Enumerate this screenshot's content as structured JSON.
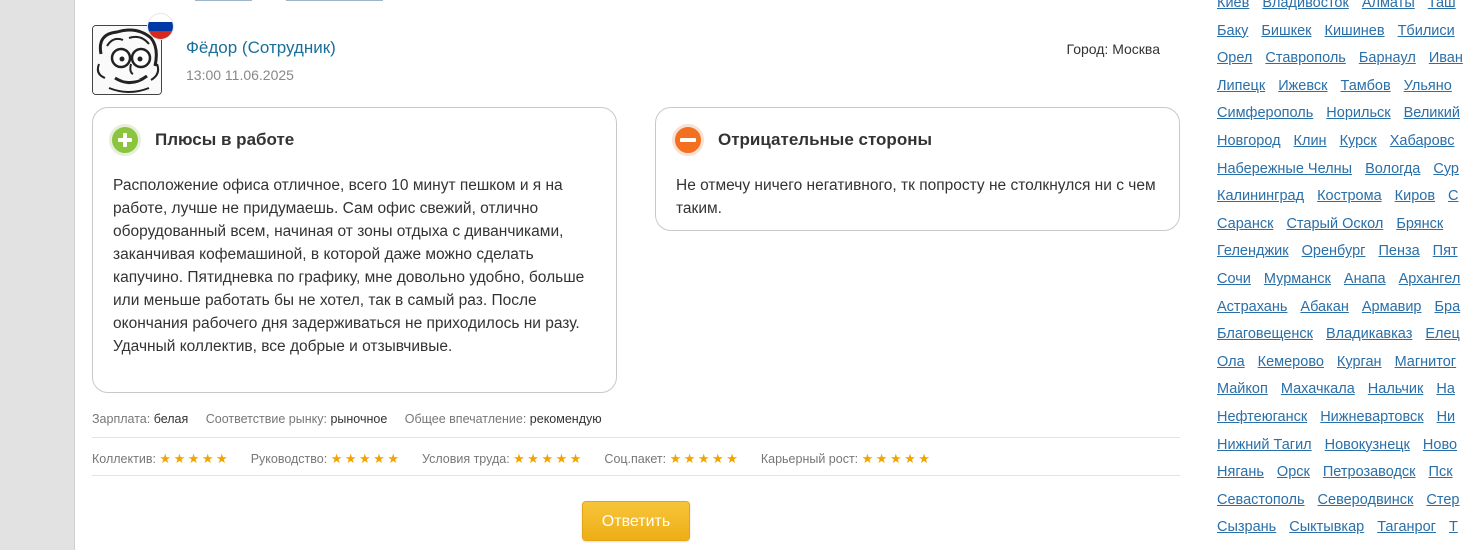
{
  "review": {
    "author_name": "Фёдор (Сотрудник)",
    "datetime": "13:00 11.06.2025",
    "city": "Город: Москва",
    "avatar_icon": "cartoon-face-avatar",
    "flag_icon": "russia-flag-icon",
    "pros": {
      "title": "Плюсы в работе",
      "icon": "plus-circle-icon",
      "text": "Расположение офиса отличное, всего 10 минут пешком и я на работе, лучше не придумаешь. Сам офис свежий, отлично оборудованный всем, начиная от зоны отдыха с диванчиками, заканчивая кофемашиной, в которой даже можно сделать капучино. Пятидневка по графику, мне довольно удобно, больше или меньше работать бы не хотел, так в самый раз. После окончания рабочего дня задерживаться не приходилось ни разу. Удачный коллектив, все добрые и отзывчивые."
    },
    "cons": {
      "title": "Отрицательные стороны",
      "icon": "minus-circle-icon",
      "text": "Не отмечу ничего негативного, тк попросту не столкнулся ни с чем таким."
    },
    "meta": [
      {
        "label": "Зарплата:",
        "value": "белая"
      },
      {
        "label": "Соответствие рынку:",
        "value": "рыночное"
      },
      {
        "label": "Общее впечатление:",
        "value": "рекомендую"
      }
    ],
    "ratings": [
      {
        "label": "Коллектив:",
        "stars": 5
      },
      {
        "label": "Руководство:",
        "stars": 5
      },
      {
        "label": "Условия труда:",
        "stars": 5
      },
      {
        "label": "Соц.пакет:",
        "stars": 5
      },
      {
        "label": "Карьерный рост:",
        "stars": 5
      }
    ],
    "reply_label": "Ответить"
  },
  "colors": {
    "link": "#2a6fa8",
    "author": "#1a6f9a",
    "star": "#f0a400",
    "button": "#f2b824",
    "plus": "#8bc53f",
    "minus": "#f37021"
  },
  "cities": [
    [
      "Киев",
      "Владивосток",
      "Алматы",
      "Таш"
    ],
    [
      "Баку",
      "Бишкек",
      "Кишинев",
      "Тбилиси"
    ],
    [
      "Орел",
      "Ставрополь",
      "Барнаул",
      "Иван"
    ],
    [
      "Липецк",
      "Ижевск",
      "Тамбов",
      "Ульяно"
    ],
    [
      "Симферополь",
      "Норильск",
      "Великий"
    ],
    [
      "Новгород",
      "Клин",
      "Курск",
      "Хабаровс"
    ],
    [
      "Набережные Челны",
      "Вологда",
      "Сур"
    ],
    [
      "Калининград",
      "Кострома",
      "Киров",
      "С"
    ],
    [
      "Саранск",
      "Старый Оскол",
      "Брянск"
    ],
    [
      "Геленджик",
      "Оренбург",
      "Пенза",
      "Пят"
    ],
    [
      "Сочи",
      "Мурманск",
      "Анапа",
      "Архангел"
    ],
    [
      "Астрахань",
      "Абакан",
      "Армавир",
      "Бра"
    ],
    [
      "Благовещенск",
      "Владикавказ",
      "Елец"
    ],
    [
      "Ола",
      "Кемерово",
      "Курган",
      "Магнитог"
    ],
    [
      "Майкоп",
      "Махачкала",
      "Нальчик",
      "На"
    ],
    [
      "Нефтеюганск",
      "Нижневартовск",
      "Ни"
    ],
    [
      "Нижний Тагил",
      "Новокузнецк",
      "Ново"
    ],
    [
      "Нягань",
      "Орск",
      "Петрозаводск",
      "Пск"
    ],
    [
      "Севастополь",
      "Северодвинск",
      "Стер"
    ],
    [
      "Сызрань",
      "Сыктывкар",
      "Таганрог",
      "Т"
    ]
  ]
}
